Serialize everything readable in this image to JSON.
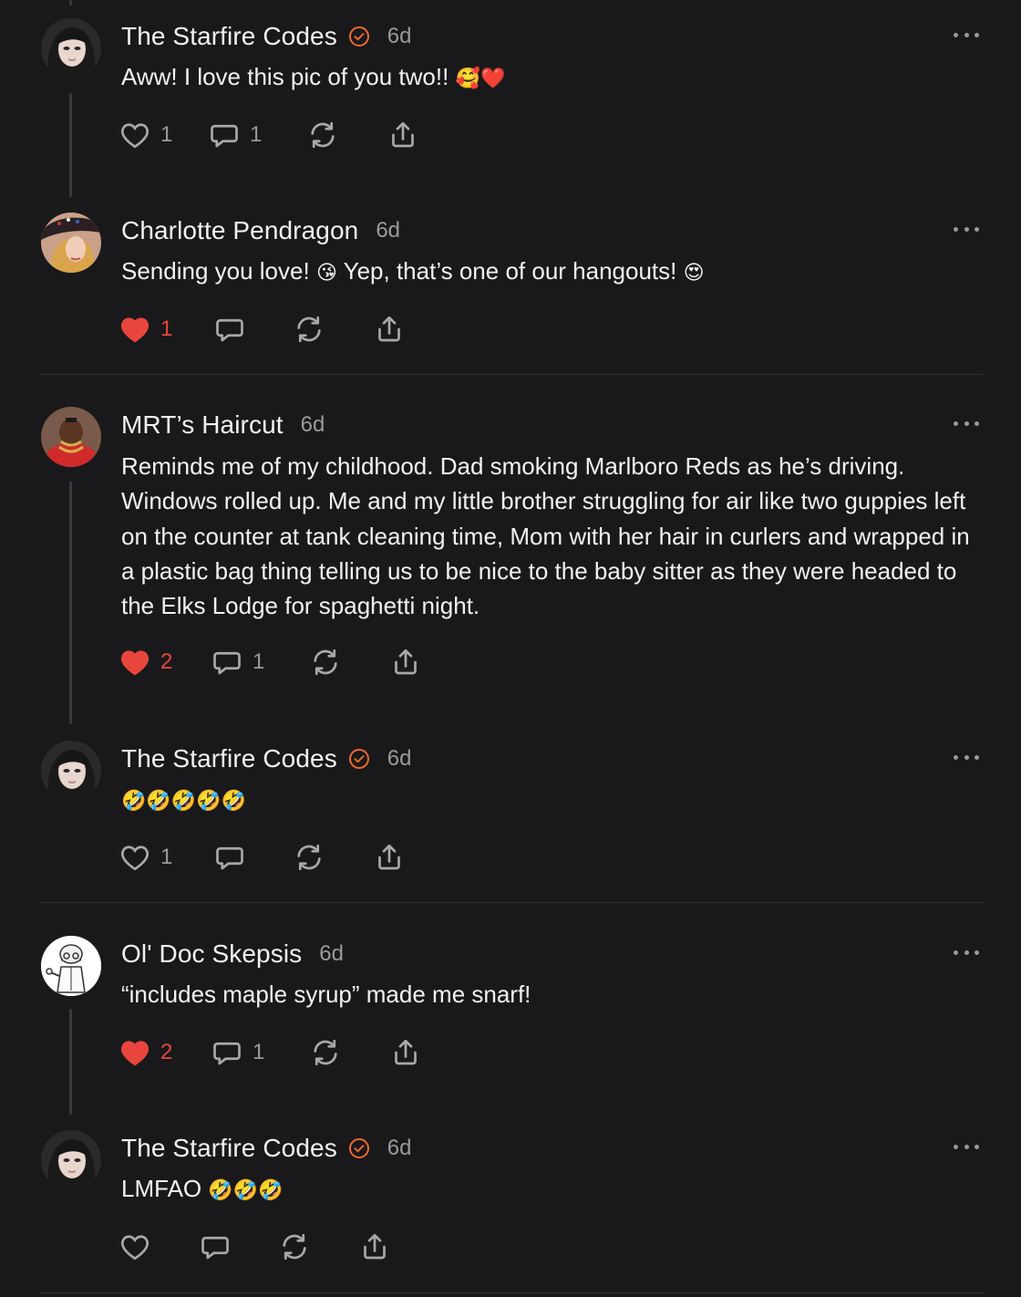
{
  "colors": {
    "accent": "#e8453c",
    "verified": "#f0682b",
    "background": "#19191b",
    "muted": "#9a9a9e"
  },
  "comments": [
    {
      "author": "The Starfire Codes",
      "verified": true,
      "time": "6d",
      "text": "Aww! I love this pic of you two!!",
      "emoji": "🥰❤️",
      "likes": "1",
      "liked": false,
      "replies": "1",
      "avatar": "woman-dark-hair"
    },
    {
      "author": "Charlotte Pendragon",
      "verified": false,
      "time": "6d",
      "text": "Sending you love! ",
      "emoji": "😘",
      "text2": " Yep, that’s one of our hangouts! ",
      "emoji2": "😍",
      "likes": "1",
      "liked": true,
      "replies": "",
      "avatar": "woman-hat"
    },
    {
      "author": "MRT’s Haircut",
      "verified": false,
      "time": "6d",
      "text": "Reminds me of my childhood. Dad smoking Marlboro Reds as he’s driving. Windows rolled up. Me and my little brother struggling for air like two guppies left on the counter at tank cleaning time, Mom with her hair in curlers and wrapped in a plastic bag thing telling us to be nice to the baby sitter as they were headed to the Elks Lodge for spaghetti night.",
      "likes": "2",
      "liked": true,
      "replies": "1",
      "avatar": "man-red-outfit"
    },
    {
      "author": "The Starfire Codes",
      "verified": true,
      "time": "6d",
      "text": "",
      "emoji": "🤣🤣🤣🤣🤣",
      "likes": "1",
      "liked": false,
      "replies": "",
      "avatar": "woman-dark-hair"
    },
    {
      "author": "Ol' Doc Skepsis",
      "verified": false,
      "time": "6d",
      "text": "“includes maple syrup” made me snarf!",
      "likes": "2",
      "liked": true,
      "replies": "1",
      "avatar": "cartoon-doctor"
    },
    {
      "author": "The Starfire Codes",
      "verified": true,
      "time": "6d",
      "text": "LMFAO ",
      "emoji": "🤣🤣🤣",
      "likes": "",
      "liked": false,
      "replies": "",
      "avatar": "woman-dark-hair"
    }
  ]
}
